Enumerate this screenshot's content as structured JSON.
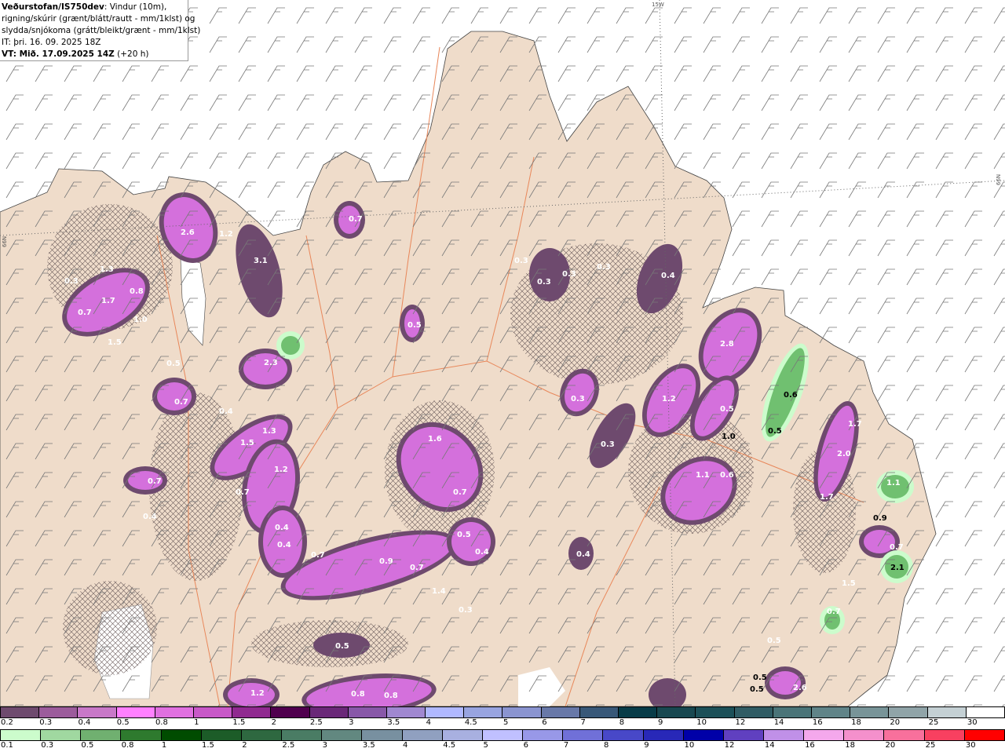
{
  "header": {
    "source": "Veðurstofan/IS750dev",
    "desc1": ": Vindur (10m),",
    "desc2": "rigning/skúrir (grænt/blátt/rautt - mm/1klst) og",
    "desc3": "slydda/snjókoma (grátt/bleikt/grænt - mm/1klst)",
    "it": "IT: þri. 16. 09. 2025 18Z",
    "vt_bold": "VT: Mið. 17.09.2025 14Z",
    "vt_lead": " (+20 h)"
  },
  "grid_labels": {
    "lon": "15W",
    "lat_left": "66N",
    "lat_right": "66N"
  },
  "colors": {
    "land": "#efdcca",
    "sea": "#ffffff",
    "roads": "#e8875a"
  },
  "snow_scale": {
    "ticks": [
      "0.2",
      "0.3",
      "0.4",
      "0.5",
      "0.8",
      "1",
      "1.5",
      "2",
      "2.5",
      "3",
      "3.5",
      "4",
      "4.5",
      "5",
      "6",
      "7",
      "8",
      "9",
      "10",
      "12",
      "14",
      "16",
      "18",
      "20",
      "25",
      "30"
    ],
    "colors": [
      "#6e4a6e",
      "#9c5c9c",
      "#c878c8",
      "#ff80ff",
      "#e070e0",
      "#c858c8",
      "#902a90",
      "#50004e",
      "#6a2878",
      "#8858a8",
      "#a088d0",
      "#b0b8ff",
      "#98a4e0",
      "#8a94d0",
      "#6878a8",
      "#385878",
      "#083c48",
      "#184850",
      "#1c5058",
      "#305c64",
      "#4a7478",
      "#608488",
      "#789498",
      "#90a4a8",
      "#c4d0d4",
      "#ffffff"
    ]
  },
  "rain_scale": {
    "ticks": [
      "0.1",
      "0.3",
      "0.5",
      "0.8",
      "1",
      "1.5",
      "2",
      "2.5",
      "3",
      "3.5",
      "4",
      "4.5",
      "5",
      "6",
      "7",
      "8",
      "9",
      "10",
      "12",
      "14",
      "16",
      "18",
      "20",
      "25",
      "30"
    ],
    "colors": [
      "#ccfccc",
      "#a0d8a0",
      "#70b070",
      "#2e7a2e",
      "#004c00",
      "#1c5c28",
      "#2e6840",
      "#4a7c64",
      "#628880",
      "#7890a0",
      "#90a0c0",
      "#a8b0e0",
      "#c0c0ff",
      "#9898e8",
      "#7070d8",
      "#4848c8",
      "#2828b8",
      "#0000a8",
      "#6040c0",
      "#c090e8",
      "#f4a8ec",
      "#f490cc",
      "#f8709c",
      "#f84060",
      "#ff0000"
    ]
  },
  "precip_labels": [
    "0.3",
    "1.3",
    "1.7",
    "0.8",
    "0.7",
    "1.0",
    "1.5",
    "0.5",
    "0.7",
    "0.4",
    "0.7",
    "0.4",
    "2.6",
    "1.2",
    "3.1",
    "0.7",
    "2.3",
    "1.5",
    "1.3",
    "1.2",
    "0.7",
    "0.4",
    "0.4",
    "0.7",
    "0.9",
    "0.7",
    "1.4",
    "0.5",
    "1.6",
    "0.7",
    "0.5",
    "0.4",
    "0.3",
    "0.3",
    "0.3",
    "0.3",
    "0.3",
    "0.4",
    "0.3",
    "0.3",
    "1.2",
    "2.8",
    "0.5",
    "1.0",
    "0.5",
    "0.6",
    "1.1",
    "0.6",
    "0.4",
    "0.5",
    "1.2",
    "0.8",
    "0.8",
    "1.7",
    "2.0",
    "1.7",
    "1.1",
    "0.9",
    "0.7",
    "2.1",
    "1.5",
    "0.7",
    "0.5",
    "0.5",
    "2.6",
    "0.5"
  ]
}
